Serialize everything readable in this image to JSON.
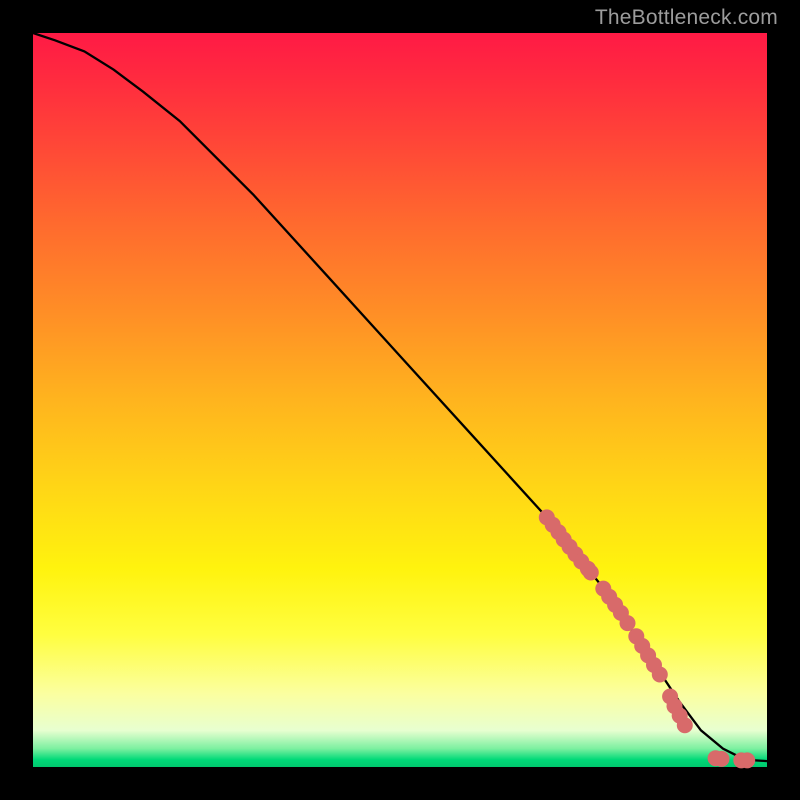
{
  "watermark": "TheBottleneck.com",
  "chart_data": {
    "type": "line",
    "title": "",
    "xlabel": "",
    "ylabel": "",
    "xlim": [
      0,
      100
    ],
    "ylim": [
      0,
      100
    ],
    "grid": false,
    "legend": false,
    "background_gradient": {
      "direction": "top-to-bottom",
      "stops": [
        {
          "pos": 0,
          "color": "#ff1a45"
        },
        {
          "pos": 50,
          "color": "#ffb41e"
        },
        {
          "pos": 80,
          "color": "#fff30e"
        },
        {
          "pos": 97,
          "color": "#7cf0a0"
        },
        {
          "pos": 100,
          "color": "#00c86e"
        }
      ]
    },
    "series": [
      {
        "name": "bottleneck-curve",
        "style": "line",
        "color": "#000000",
        "x": [
          0,
          3,
          7,
          11,
          15,
          20,
          30,
          40,
          50,
          60,
          70,
          78,
          84,
          88,
          91,
          94,
          97,
          100
        ],
        "y": [
          100,
          99,
          97.5,
          95,
          92,
          88,
          78,
          67,
          56,
          45,
          34,
          24,
          15,
          9,
          5,
          2.5,
          1,
          0.8
        ]
      },
      {
        "name": "highlighted-points",
        "style": "scatter",
        "color": "#d86a6a",
        "marker_radius": 8,
        "x": [
          70.0,
          70.8,
          71.6,
          72.3,
          73.1,
          73.9,
          74.7,
          75.6,
          76.0,
          77.7,
          78.5,
          79.3,
          80.1,
          81.0,
          82.2,
          83.0,
          83.8,
          84.6,
          85.4,
          86.8,
          87.4,
          88.1,
          88.8,
          93.0,
          93.8,
          96.5,
          97.3
        ],
        "y": [
          34.0,
          33.0,
          32.0,
          31.0,
          30.0,
          29.0,
          28.0,
          27.0,
          26.5,
          24.3,
          23.2,
          22.1,
          21.0,
          19.6,
          17.8,
          16.5,
          15.2,
          13.9,
          12.6,
          9.6,
          8.3,
          7.0,
          5.7,
          1.2,
          1.1,
          0.9,
          0.9
        ]
      }
    ]
  }
}
